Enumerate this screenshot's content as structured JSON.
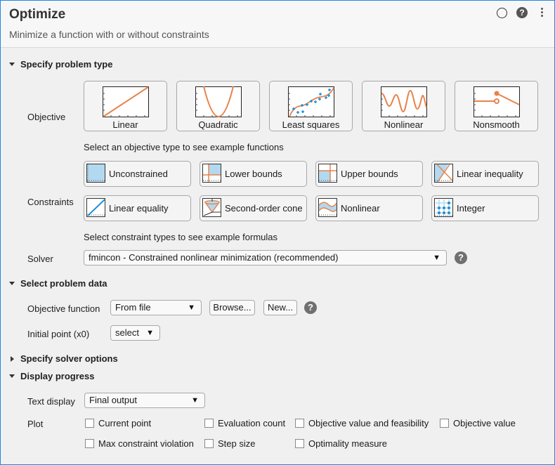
{
  "header": {
    "title": "Optimize",
    "subtitle": "Minimize a function with or without constraints",
    "icons": [
      "status-circle-icon",
      "help-icon",
      "more-options-icon"
    ]
  },
  "sections": {
    "problem_type": "Specify problem type",
    "problem_data": "Select problem data",
    "solver_options": "Specify solver options",
    "display_progress": "Display progress"
  },
  "objective": {
    "label": "Objective",
    "hint": "Select an objective type to see example functions",
    "types": [
      {
        "label": "Linear",
        "icon": "linear-plot-icon"
      },
      {
        "label": "Quadratic",
        "icon": "quadratic-plot-icon"
      },
      {
        "label": "Least squares",
        "icon": "least-squares-plot-icon"
      },
      {
        "label": "Nonlinear",
        "icon": "nonlinear-plot-icon"
      },
      {
        "label": "Nonsmooth",
        "icon": "nonsmooth-plot-icon"
      }
    ]
  },
  "constraints": {
    "label": "Constraints",
    "hint": "Select constraint types to see example formulas",
    "types": [
      {
        "label": "Unconstrained",
        "icon": "unconstrained-icon"
      },
      {
        "label": "Lower bounds",
        "icon": "lower-bounds-icon"
      },
      {
        "label": "Upper bounds",
        "icon": "upper-bounds-icon"
      },
      {
        "label": "Linear inequality",
        "icon": "linear-inequality-icon"
      },
      {
        "label": "Linear equality",
        "icon": "linear-equality-icon"
      },
      {
        "label": "Second-order cone",
        "icon": "second-order-cone-icon"
      },
      {
        "label": "Nonlinear",
        "icon": "nonlinear-constraint-icon"
      },
      {
        "label": "Integer",
        "icon": "integer-icon"
      }
    ]
  },
  "solver": {
    "label": "Solver",
    "value": "fmincon - Constrained nonlinear minimization (recommended)"
  },
  "problem_data": {
    "objective_function_label": "Objective function",
    "objective_function_value": "From file",
    "browse_label": "Browse...",
    "new_label": "New...",
    "initial_point_label": "Initial point (x0)",
    "initial_point_value": "select"
  },
  "display": {
    "text_display_label": "Text display",
    "text_display_value": "Final output",
    "plot_label": "Plot",
    "plots": [
      {
        "label": "Current point",
        "checked": false
      },
      {
        "label": "Evaluation count",
        "checked": false
      },
      {
        "label": "Objective value and feasibility",
        "checked": false
      },
      {
        "label": "Objective value",
        "checked": false
      },
      {
        "label": "Max constraint violation",
        "checked": false
      },
      {
        "label": "Step size",
        "checked": false
      },
      {
        "label": "Optimality measure",
        "checked": false
      }
    ]
  },
  "glyphs": {
    "dropdown_arrow": "▼",
    "help": "?"
  },
  "colors": {
    "accent_border": "#1e88e5",
    "curve_orange": "#e8834a",
    "marker_blue": "#1f8fd6",
    "region_blue": "#b3d9f0"
  }
}
